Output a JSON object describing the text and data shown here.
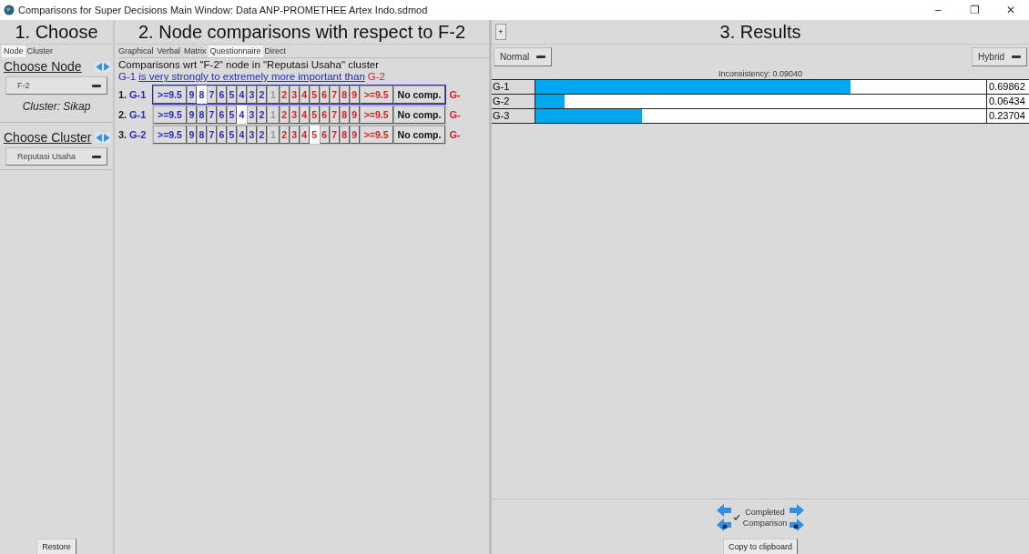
{
  "window": {
    "title": "Comparisons for Super Decisions Main Window: Data ANP-PROMETHEE Artex Indo.sdmod",
    "controls": [
      "–",
      "❐",
      "✕"
    ]
  },
  "choose": {
    "heading": "1. Choose",
    "tabs": [
      {
        "label": "Node",
        "selected": true
      },
      {
        "label": "Cluster",
        "selected": false
      }
    ],
    "node_label": "Choose Node",
    "node_value": "F-2",
    "cluster_info": "Cluster: Sikap",
    "cluster_label": "Choose Cluster",
    "cluster_value": "Reputasi Usaha",
    "restore": "Restore"
  },
  "comparisons": {
    "heading": "2. Node comparisons with respect to F-2",
    "tabs": [
      {
        "label": "Graphical",
        "selected": false
      },
      {
        "label": "Verbal",
        "selected": false
      },
      {
        "label": "Matrix",
        "selected": false
      },
      {
        "label": "Questionnaire",
        "selected": true
      },
      {
        "label": "Direct",
        "selected": false
      }
    ],
    "caption": "Comparisons wrt \"F-2\" node in \"Reputasi Usaha\" cluster",
    "verdict_left": "G-1",
    "verdict_text": "is very strongly to extremely more important than",
    "verdict_right": "G-2",
    "rows": [
      {
        "number": "1.",
        "left": "G-1",
        "right": "G-",
        "focused": true,
        "cells": [
          {
            "label": ">=9.5",
            "kind": "left",
            "selected": false
          },
          {
            "label": "9",
            "kind": "left",
            "selected": false
          },
          {
            "label": "8",
            "kind": "left",
            "selected": true
          },
          {
            "label": "7",
            "kind": "left",
            "selected": false
          },
          {
            "label": "6",
            "kind": "left",
            "selected": false
          },
          {
            "label": "5",
            "kind": "left",
            "selected": false
          },
          {
            "label": "4",
            "kind": "left",
            "selected": false
          },
          {
            "label": "3",
            "kind": "left",
            "selected": false
          },
          {
            "label": "2",
            "kind": "left",
            "selected": false
          },
          {
            "label": "1",
            "kind": "equal",
            "selected": false
          },
          {
            "label": "2",
            "kind": "right",
            "selected": false
          },
          {
            "label": "3",
            "kind": "right",
            "selected": false
          },
          {
            "label": "4",
            "kind": "right",
            "selected": false
          },
          {
            "label": "5",
            "kind": "right",
            "selected": false
          },
          {
            "label": "6",
            "kind": "right",
            "selected": false
          },
          {
            "label": "7",
            "kind": "right",
            "selected": false
          },
          {
            "label": "8",
            "kind": "right",
            "selected": false
          },
          {
            "label": "9",
            "kind": "right",
            "selected": false
          },
          {
            "label": ">=9.5",
            "kind": "right",
            "selected": false
          },
          {
            "label": "No comp.",
            "kind": "none",
            "selected": false
          }
        ]
      },
      {
        "number": "2.",
        "left": "G-1",
        "right": "G-",
        "focused": false,
        "cells": [
          {
            "label": ">=9.5",
            "kind": "left",
            "selected": false
          },
          {
            "label": "9",
            "kind": "left",
            "selected": false
          },
          {
            "label": "8",
            "kind": "left",
            "selected": false
          },
          {
            "label": "7",
            "kind": "left",
            "selected": false
          },
          {
            "label": "6",
            "kind": "left",
            "selected": false
          },
          {
            "label": "5",
            "kind": "left",
            "selected": false
          },
          {
            "label": "4",
            "kind": "left",
            "selected": true
          },
          {
            "label": "3",
            "kind": "left",
            "selected": false
          },
          {
            "label": "2",
            "kind": "left",
            "selected": false
          },
          {
            "label": "1",
            "kind": "equal",
            "selected": false
          },
          {
            "label": "2",
            "kind": "right",
            "selected": false
          },
          {
            "label": "3",
            "kind": "right",
            "selected": false
          },
          {
            "label": "4",
            "kind": "right",
            "selected": false
          },
          {
            "label": "5",
            "kind": "right",
            "selected": false
          },
          {
            "label": "6",
            "kind": "right",
            "selected": false
          },
          {
            "label": "7",
            "kind": "right",
            "selected": false
          },
          {
            "label": "8",
            "kind": "right",
            "selected": false
          },
          {
            "label": "9",
            "kind": "right",
            "selected": false
          },
          {
            "label": ">=9.5",
            "kind": "right",
            "selected": false
          },
          {
            "label": "No comp.",
            "kind": "none",
            "selected": false
          }
        ]
      },
      {
        "number": "3.",
        "left": "G-2",
        "right": "G-",
        "focused": false,
        "cells": [
          {
            "label": ">=9.5",
            "kind": "left",
            "selected": false
          },
          {
            "label": "9",
            "kind": "left",
            "selected": false
          },
          {
            "label": "8",
            "kind": "left",
            "selected": false
          },
          {
            "label": "7",
            "kind": "left",
            "selected": false
          },
          {
            "label": "6",
            "kind": "left",
            "selected": false
          },
          {
            "label": "5",
            "kind": "left",
            "selected": false
          },
          {
            "label": "4",
            "kind": "left",
            "selected": false
          },
          {
            "label": "3",
            "kind": "left",
            "selected": false
          },
          {
            "label": "2",
            "kind": "left",
            "selected": false
          },
          {
            "label": "1",
            "kind": "equal",
            "selected": false
          },
          {
            "label": "2",
            "kind": "right",
            "selected": false
          },
          {
            "label": "3",
            "kind": "right",
            "selected": false
          },
          {
            "label": "4",
            "kind": "right",
            "selected": false
          },
          {
            "label": "5",
            "kind": "right",
            "selected": true
          },
          {
            "label": "6",
            "kind": "right",
            "selected": false
          },
          {
            "label": "7",
            "kind": "right",
            "selected": false
          },
          {
            "label": "8",
            "kind": "right",
            "selected": false
          },
          {
            "label": "9",
            "kind": "right",
            "selected": false
          },
          {
            "label": ">=9.5",
            "kind": "right",
            "selected": false
          },
          {
            "label": "No comp.",
            "kind": "none",
            "selected": false
          }
        ]
      }
    ]
  },
  "results": {
    "expand": "+",
    "heading": "3. Results",
    "mode": "Normal",
    "view": "Hybrid",
    "inconsistency": "Inconsistency: 0.09040",
    "rows": [
      {
        "name": "G-1",
        "level": 0.69862,
        "value": "0.69862"
      },
      {
        "name": "G-2",
        "level": 0.06434,
        "value": "0.06434"
      },
      {
        "name": "G-3",
        "level": 0.23704,
        "value": "0.23704"
      }
    ],
    "completed": {
      "checked": true,
      "label": "Completed Comparison"
    },
    "copy": "Copy to clipboard"
  }
}
